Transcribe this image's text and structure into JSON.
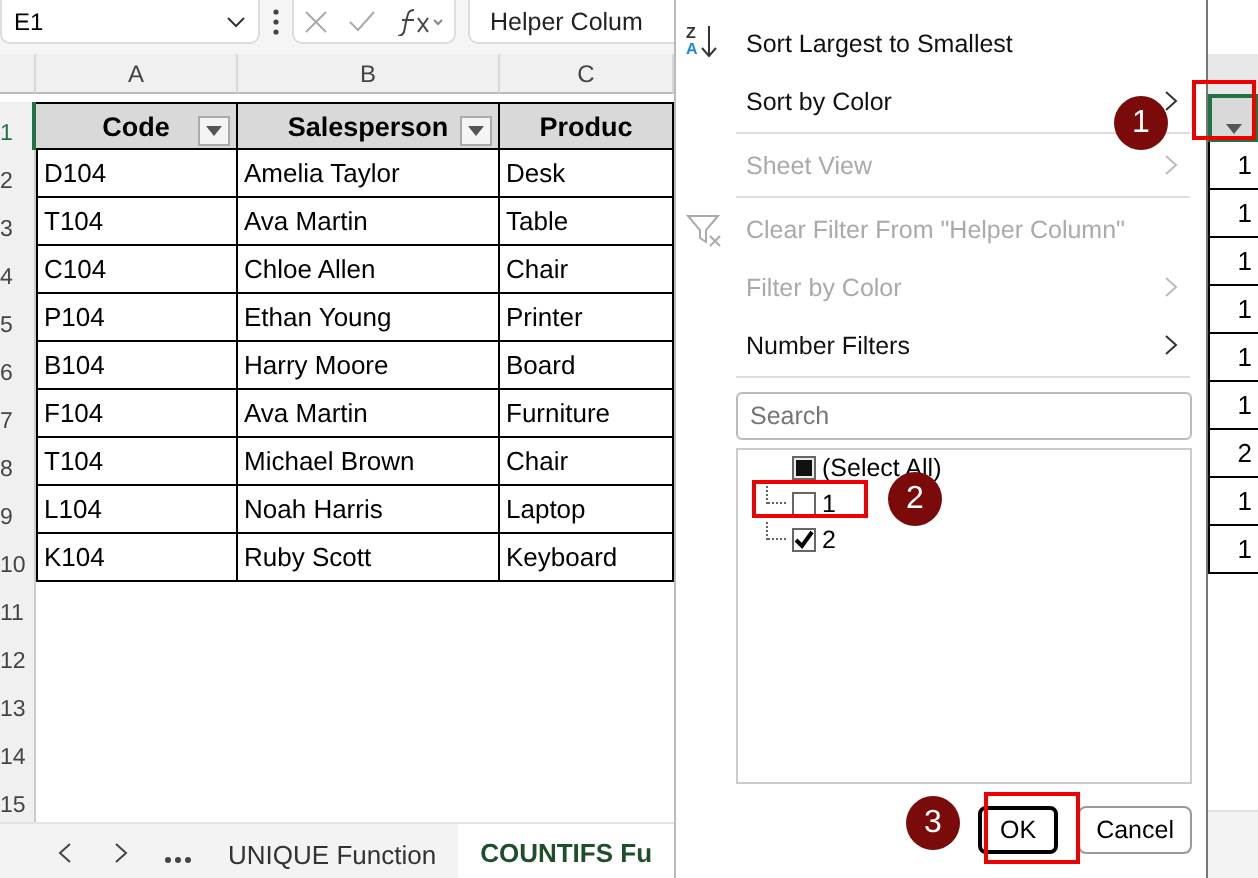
{
  "formula_bar": {
    "name_box": "E1",
    "formula": "Helper Colum"
  },
  "columns": [
    "A",
    "B",
    "C"
  ],
  "header_row": {
    "num": "1",
    "selected": true,
    "cells": [
      {
        "text": "Code",
        "filter": true
      },
      {
        "text": "Salesperson",
        "filter": true
      },
      {
        "text": "Produc",
        "filter": false
      }
    ]
  },
  "rows": [
    {
      "num": "2",
      "cells": [
        "D104",
        "Amelia Taylor",
        "Desk"
      ]
    },
    {
      "num": "3",
      "cells": [
        "T104",
        "Ava Martin",
        "Table"
      ]
    },
    {
      "num": "4",
      "cells": [
        "C104",
        "Chloe Allen",
        "Chair"
      ]
    },
    {
      "num": "5",
      "cells": [
        "P104",
        "Ethan Young",
        "Printer"
      ]
    },
    {
      "num": "6",
      "cells": [
        "B104",
        "Harry Moore",
        "Board"
      ]
    },
    {
      "num": "7",
      "cells": [
        "F104",
        "Ava Martin",
        "Furniture"
      ]
    },
    {
      "num": "8",
      "cells": [
        "T104",
        "Michael Brown",
        "Chair"
      ]
    },
    {
      "num": "9",
      "cells": [
        "L104",
        "Noah Harris",
        "Laptop"
      ]
    },
    {
      "num": "10",
      "cells": [
        "K104",
        "Ruby Scott",
        "Keyboard"
      ]
    }
  ],
  "empty_rows": [
    "11",
    "12",
    "13",
    "14",
    "15"
  ],
  "sheet_tabs": [
    {
      "label": "UNIQUE Function",
      "selected": false
    },
    {
      "label": "COUNTIFS Fu",
      "selected": true
    }
  ],
  "helper_column": {
    "selected": true,
    "values": [
      "1",
      "1",
      "1",
      "1",
      "1",
      "1",
      "2",
      "1",
      "1"
    ]
  },
  "filter_menu": {
    "items": [
      {
        "kind": "sort",
        "icon_top": "Z",
        "icon_bottom": "A",
        "label": "Sort Largest to Smallest",
        "disabled": false,
        "submenu": false
      },
      {
        "kind": "item",
        "label": "Sort by Color",
        "disabled": false,
        "submenu": true
      },
      {
        "kind": "divider"
      },
      {
        "kind": "item",
        "label": "Sheet View",
        "disabled": true,
        "submenu": true
      },
      {
        "kind": "divider"
      },
      {
        "kind": "clear",
        "label": "Clear Filter From \"Helper Column\"",
        "disabled": true,
        "submenu": false
      },
      {
        "kind": "item",
        "label": "Filter by Color",
        "disabled": true,
        "submenu": true
      },
      {
        "kind": "item",
        "label": "Number Filters",
        "disabled": false,
        "submenu": true
      },
      {
        "kind": "divider"
      }
    ],
    "search": {
      "placeholder": "Search"
    },
    "values": [
      {
        "label": "(Select All)",
        "checked": false,
        "partial": true
      },
      {
        "label": "1",
        "checked": false,
        "partial": false
      },
      {
        "label": "2",
        "checked": true,
        "partial": false
      }
    ],
    "buttons": [
      {
        "label": "OK",
        "default": true
      },
      {
        "label": "Cancel",
        "default": false
      }
    ]
  },
  "annotations": [
    {
      "number": "1"
    },
    {
      "number": "2"
    },
    {
      "number": "3"
    }
  ]
}
